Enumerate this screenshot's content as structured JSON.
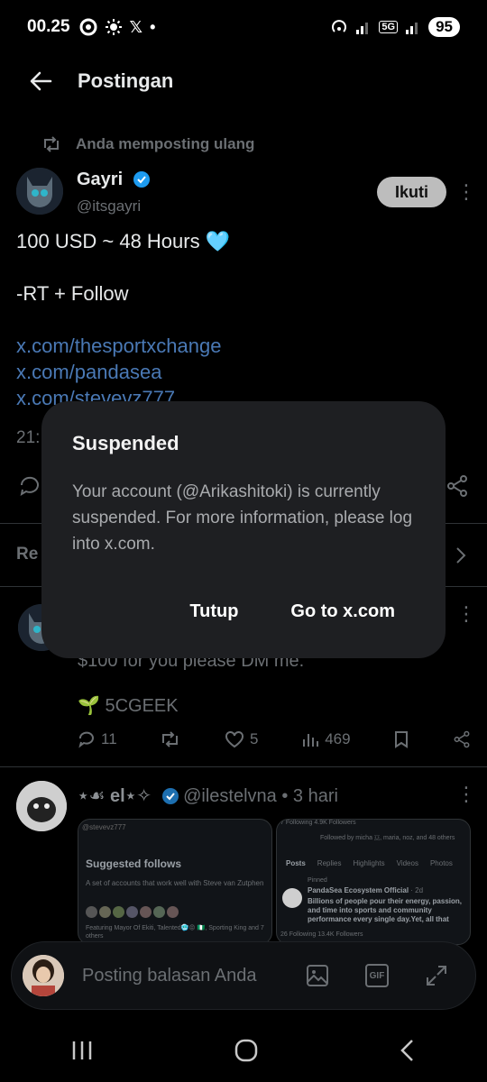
{
  "status_bar": {
    "time": "00.25",
    "x_icon": "𝕏",
    "dot": "•",
    "network_badge": "5G",
    "battery": "95"
  },
  "header": {
    "title": "Postingan"
  },
  "repost": {
    "label": "Anda memposting ulang"
  },
  "main_tweet": {
    "name": "Gayri",
    "handle": "@itsgayri",
    "follow_label": "Ikuti",
    "text_line1": "100 USD ~ 48 Hours 🩵",
    "text_line2": "-RT + Follow",
    "link1": "x.com/thesportxchange",
    "link2": "x.com/pandasea",
    "link3": "x.com/stevevz777",
    "time_partial": "21:"
  },
  "replies_section": {
    "label_partial": "Re"
  },
  "reply1": {
    "text_partial": "$100 for you please DM me.",
    "code_line": "🌱 5CGEEK",
    "stats": {
      "replies": "11",
      "likes": "5",
      "views": "469"
    }
  },
  "reply2": {
    "name": "⋆☙ el⋆✧",
    "handle": "@ilestelvna",
    "time": "3 hari",
    "card_left": {
      "handle": "@stevevz777",
      "title": "Suggested follows",
      "desc": "A set of accounts that work well with Steve van Zutphen",
      "footer": "Featuring Mayor Of Ekiti, Talented🥶😡 🇳🇬, Sporting King and 7 others"
    },
    "card_right": {
      "following": "7 Following",
      "followers": "4.9K Followers",
      "followed_by": "Followed by micha 🇺, maria, noz, and 48 others",
      "tabs": [
        "Posts",
        "Replies",
        "Highlights",
        "Videos",
        "Photos"
      ],
      "pinned": "Pinned",
      "post_name": "PandaSea Ecosystem Official",
      "post_time": "· 2d",
      "post_text": "Billions of people pour their energy, passion, and time into sports and community performance every single day.Yet, all that",
      "following2": "26 Following",
      "followers2": "13.4K Followers"
    }
  },
  "modal": {
    "title": "Suspended",
    "message": "Your account (@Arikashitoki) is currently suspended. For more information, please log into x.com.",
    "close_label": "Tutup",
    "go_label": "Go to x.com"
  },
  "reply_bar": {
    "placeholder": "Posting balasan Anda",
    "gif_label": "GIF"
  },
  "colors": {
    "link": "#4a79b5",
    "verified": "#1d9bf0",
    "modal_bg": "#1e1f22"
  }
}
